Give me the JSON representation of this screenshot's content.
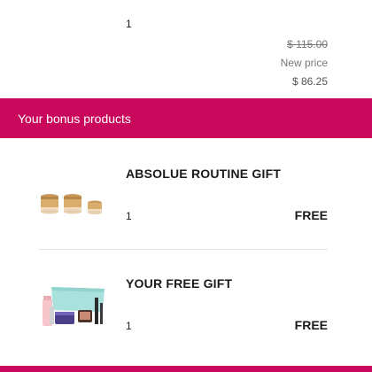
{
  "top_item": {
    "quantity": "1",
    "original_price": "$ 115.00",
    "new_price_label": "New price",
    "new_price": "$ 86.25"
  },
  "bonus_section": {
    "title": "Your bonus products",
    "banner_color": "#c9075b",
    "items": [
      {
        "name": "ABSOLUE ROUTINE GIFT",
        "quantity": "1",
        "price": "FREE",
        "image": "cream-jars-image"
      },
      {
        "name": "YOUR FREE GIFT",
        "quantity": "1",
        "price": "FREE",
        "image": "gift-set-image"
      }
    ]
  }
}
